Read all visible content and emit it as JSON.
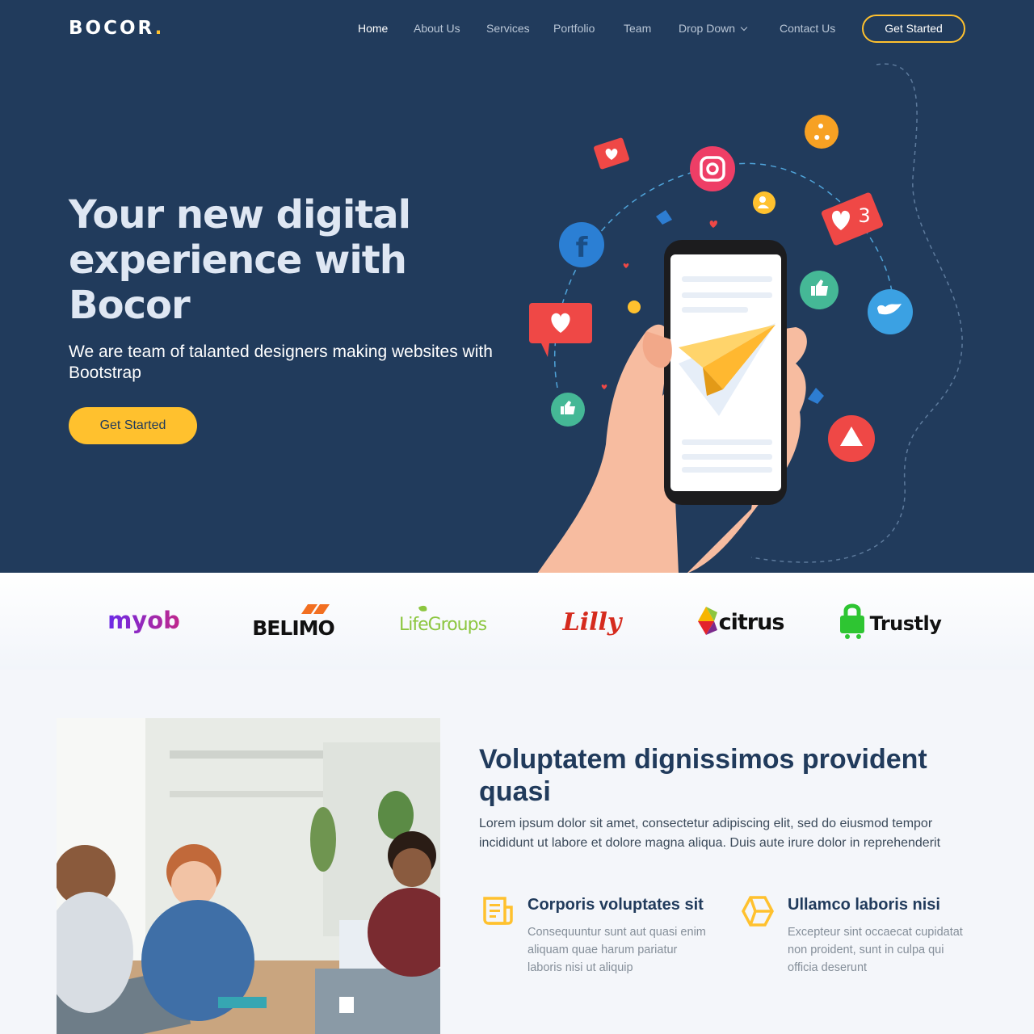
{
  "nav": {
    "logo": "BOCOR",
    "logo_dot": ".",
    "items": [
      {
        "label": "Home"
      },
      {
        "label": "About Us"
      },
      {
        "label": "Services"
      },
      {
        "label": "Portfolio"
      },
      {
        "label": "Team"
      },
      {
        "label": "Drop Down"
      },
      {
        "label": "Contact Us"
      }
    ],
    "active_item": "Home",
    "cta_label": "Get Started"
  },
  "hero": {
    "title": "Your new digital experience with Bocor",
    "subtitle": "We are team of talanted designers making websites with Bootstrap",
    "cta_label": "Get Started",
    "illustration_icons": [
      "facebook-icon",
      "instagram-icon",
      "twitter-icon",
      "like-icon",
      "heart-icon",
      "share-icon",
      "user-icon",
      "notification-badge-icon",
      "paper-plane-icon"
    ],
    "notification_count": "3"
  },
  "clients": {
    "logos": [
      {
        "name": "myob",
        "icon": "myob-logo"
      },
      {
        "name": "BELIMO",
        "icon": "belimo-logo"
      },
      {
        "name": "LifeGroups",
        "icon": "lifegroups-logo"
      },
      {
        "name": "Lilly",
        "icon": "lilly-logo"
      },
      {
        "name": "citrus",
        "icon": "citrus-logo"
      },
      {
        "name": "Trustly",
        "icon": "trustly-logo"
      }
    ]
  },
  "about": {
    "title": "Voluptatem dignissimos provident quasi",
    "text": "Lorem ipsum dolor sit amet, consectetur adipiscing elit, sed do eiusmod tempor incididunt ut labore et dolore magna aliqua. Duis aute irure dolor in reprehenderit",
    "features": [
      {
        "icon": "document-icon",
        "title": "Corporis voluptates sit",
        "text": "Consequuntur sunt aut quasi enim aliquam quae harum pariatur laboris nisi ut aliquip"
      },
      {
        "icon": "cube-icon",
        "title": "Ullamco laboris nisi",
        "text": "Excepteur sint occaecat cupidatat non proident, sunt in culpa qui officia deserunt"
      }
    ]
  },
  "colors": {
    "hero_bg": "#213b5c",
    "accent": "#ffc12e",
    "heading": "#213b5c"
  }
}
